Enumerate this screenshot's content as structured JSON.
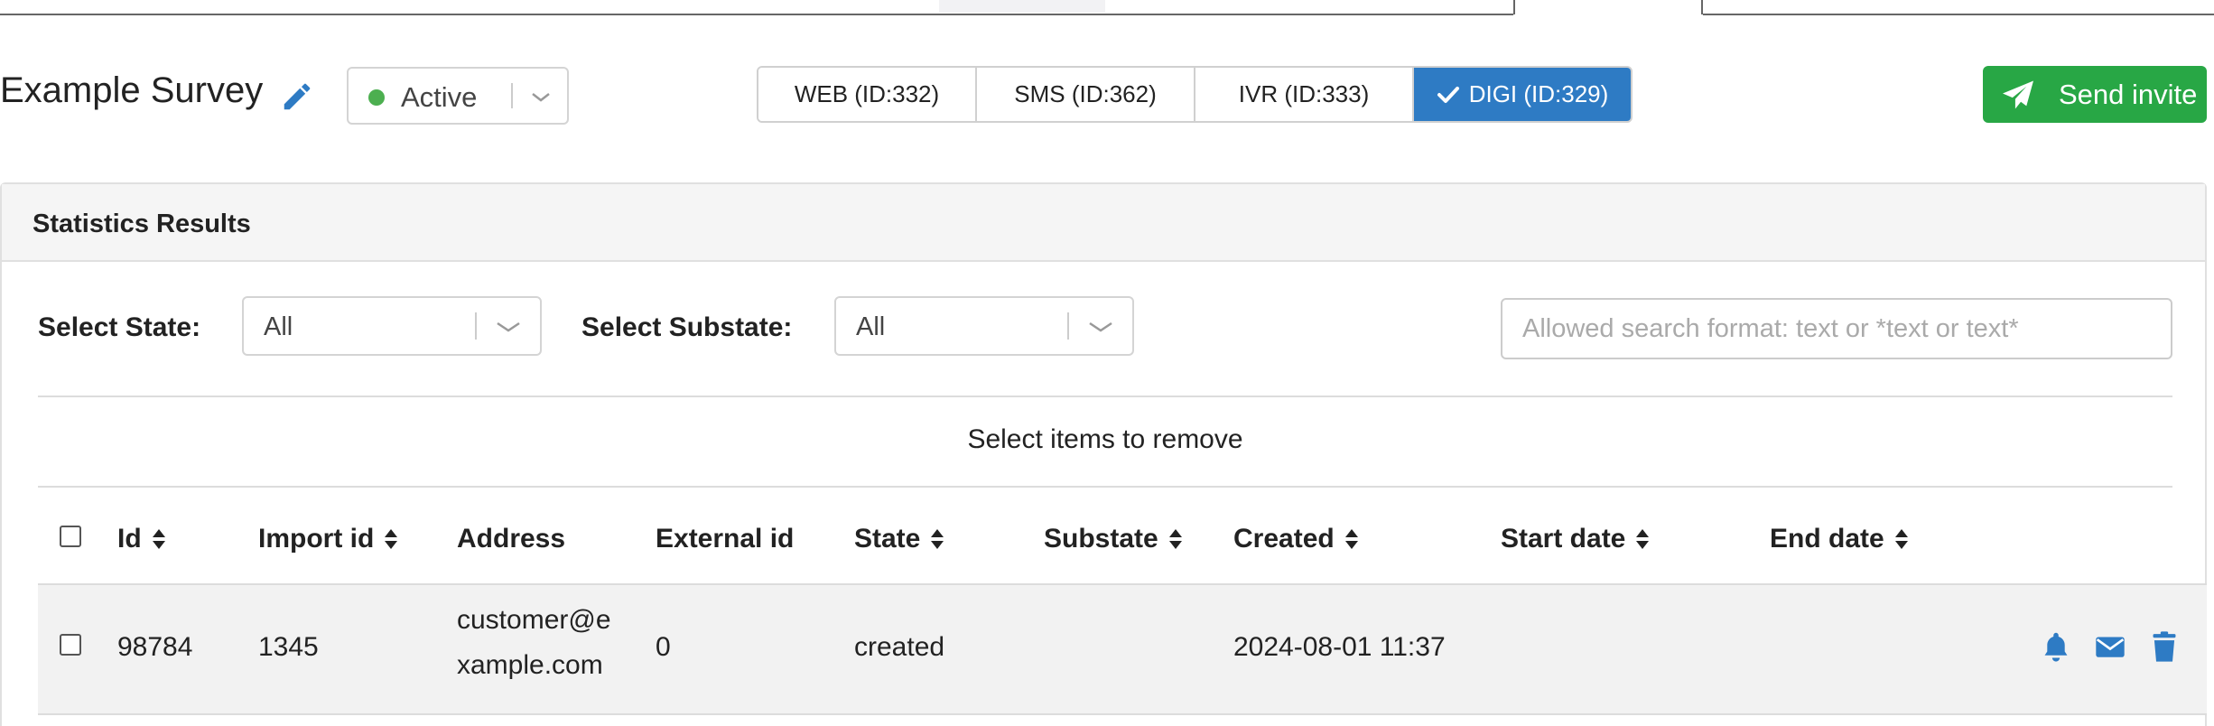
{
  "header": {
    "survey_title": "Example Survey",
    "status": {
      "label": "Active",
      "color": "#4caf50"
    },
    "channels": [
      {
        "label": "WEB (ID:332)",
        "active": false
      },
      {
        "label": "SMS (ID:362)",
        "active": false
      },
      {
        "label": "IVR (ID:333)",
        "active": false
      },
      {
        "label": "DIGI (ID:329)",
        "active": true
      }
    ],
    "send_invite_label": "Send invite"
  },
  "panel": {
    "title": "Statistics Results",
    "filters": {
      "state_label": "Select State:",
      "state_value": "All",
      "substate_label": "Select Substate:",
      "substate_value": "All",
      "search_placeholder": "Allowed search format: text or *text or text*",
      "search_value": ""
    },
    "remove_caption": "Select items to remove",
    "table": {
      "columns": [
        "Id",
        "Import id",
        "Address",
        "External id",
        "State",
        "Substate",
        "Created",
        "Start date",
        "End date"
      ],
      "rows": [
        {
          "id": "98784",
          "import_id": "1345",
          "address_line1": "customer@e",
          "address_line2": "xample.com",
          "external_id": "0",
          "state": "created",
          "substate": "",
          "created": "2024-08-01 11:37",
          "start_date": "",
          "end_date": ""
        }
      ]
    }
  },
  "colors": {
    "primary": "#2e7bc4",
    "success": "#28a745",
    "status_active": "#4caf50"
  },
  "icons": {
    "title_edit": "pencil-icon",
    "status_dropdown": "chevron-down-icon",
    "active_channel": "check-icon",
    "send": "paper-plane-icon",
    "sort": "sort-icon",
    "row_actions": [
      "bell-icon",
      "envelope-icon",
      "trash-icon"
    ]
  }
}
